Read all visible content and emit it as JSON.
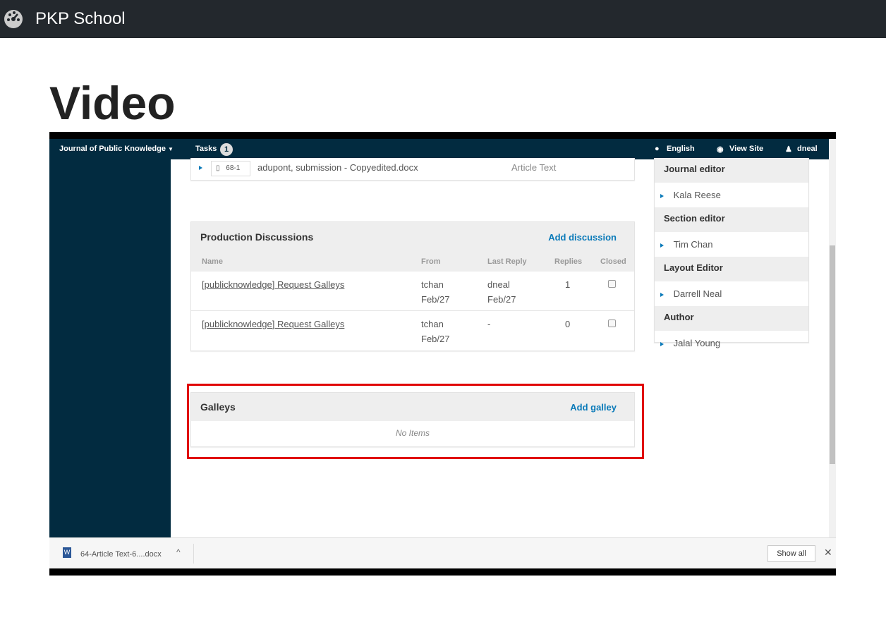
{
  "app": {
    "title": "PKP School",
    "logo_icon": "dashboard-gauge-icon"
  },
  "page": {
    "heading": "Video"
  },
  "nav": {
    "journal": "Journal of Public Knowledge",
    "tasks": "Tasks",
    "tasks_count": "1",
    "language": "English",
    "view_site": "View Site",
    "user": "dneal"
  },
  "file_row": {
    "id": "68-1",
    "name": "adupont, submission - Copyedited.docx",
    "type": "Article Text"
  },
  "discussions": {
    "title": "Production Discussions",
    "add": "Add discussion",
    "columns": [
      "Name",
      "From",
      "Last Reply",
      "Replies",
      "Closed"
    ],
    "rows": [
      {
        "name": "[publicknowledge] Request Galleys",
        "from": "tchan",
        "from_date": "Feb/27",
        "last": "dneal",
        "last_date": "Feb/27",
        "replies": "1",
        "closed": false
      },
      {
        "name": "[publicknowledge] Request Galleys",
        "from": "tchan",
        "from_date": "Feb/27",
        "last": "-",
        "last_date": "",
        "replies": "0",
        "closed": false
      }
    ]
  },
  "galleys": {
    "title": "Galleys",
    "add": "Add galley",
    "empty": "No Items",
    "highlight_color": "#e00000"
  },
  "participants": [
    {
      "role": "Journal editor",
      "name": "Kala Reese"
    },
    {
      "role": "Section editor",
      "name": "Tim Chan"
    },
    {
      "role": "Layout Editor",
      "name": "Darrell Neal"
    },
    {
      "role": "Author",
      "name": "Jalal Young"
    }
  ],
  "download_bar": {
    "file": "64-Article Text-6....docx",
    "show_all": "Show all"
  },
  "colors": {
    "nav": "#022b40",
    "link": "#0a7ab9"
  }
}
